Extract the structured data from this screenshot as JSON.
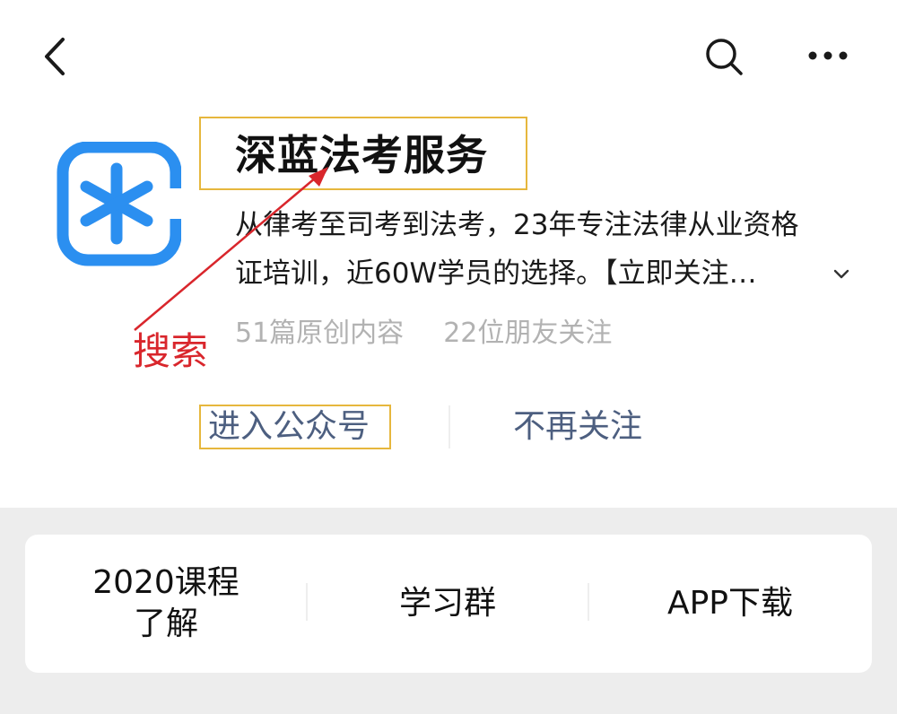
{
  "nav": {
    "back_icon": "chevron-left-icon",
    "search_icon": "search-icon",
    "more_icon": "more-icon"
  },
  "account": {
    "name": "深蓝法考服务",
    "logo_icon": "asterisk-logo-icon",
    "logo_color": "#2b8ff0",
    "description_line1": "从律考至司考到法考，23年专注法律从业资格",
    "description_line2": "证培训，近60W学员的选择。【立即关注…",
    "expand_icon": "chevron-down-icon",
    "original_count": "51篇原创内容",
    "friends_following": "22位朋友关注"
  },
  "annotation": {
    "label": "搜索",
    "color": "#d9262c",
    "highlight_color": "#e6b73d"
  },
  "actions": {
    "enter": "进入公众号",
    "unfollow": "不再关注"
  },
  "menu": {
    "item1_line1": "2020课程",
    "item1_line2": "了解",
    "item2": "学习群",
    "item3": "APP下载"
  }
}
